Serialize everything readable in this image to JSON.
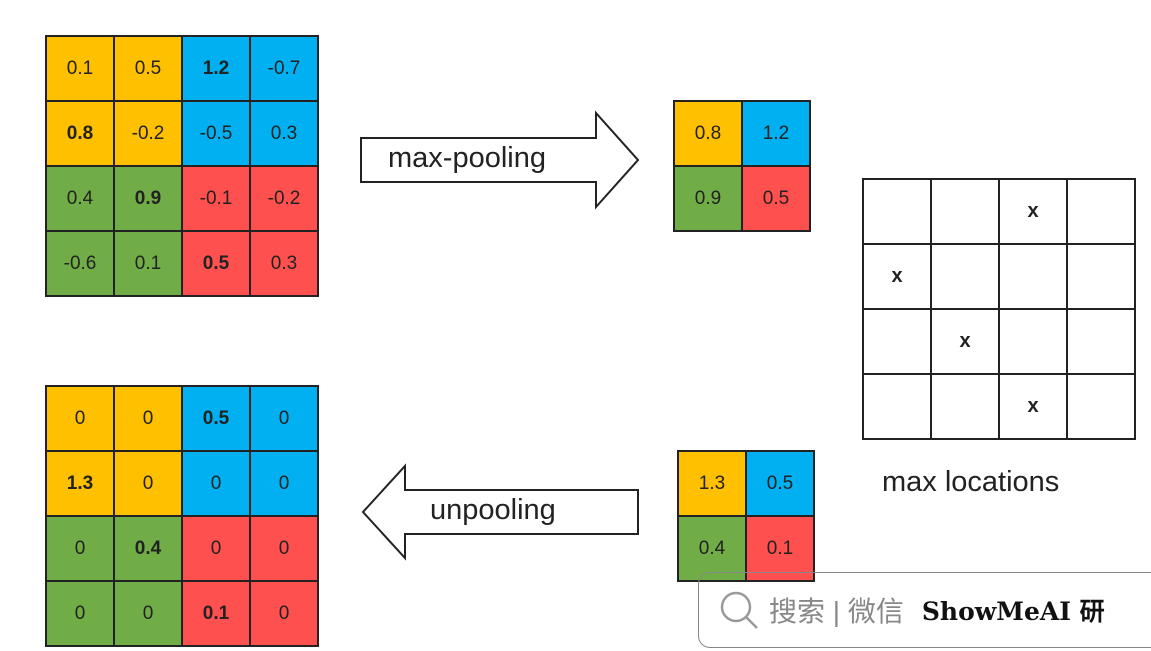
{
  "colors": {
    "yellow": "#FFC000",
    "blue": "#00B0F0",
    "green": "#70AD47",
    "red": "#FF5050"
  },
  "input_grid": {
    "values": [
      [
        "0.1",
        "0.5",
        "1.2",
        "-0.7"
      ],
      [
        "0.8",
        "-0.2",
        "-0.5",
        "0.3"
      ],
      [
        "0.4",
        "0.9",
        "-0.1",
        "-0.2"
      ],
      [
        "-0.6",
        "0.1",
        "0.5",
        "0.3"
      ]
    ],
    "bold": [
      [
        0,
        0,
        1,
        0
      ],
      [
        1,
        0,
        0,
        0
      ],
      [
        0,
        1,
        0,
        0
      ],
      [
        0,
        0,
        1,
        0
      ]
    ]
  },
  "pooled_grid": {
    "values": [
      [
        "0.8",
        "1.2"
      ],
      [
        "0.9",
        "0.5"
      ]
    ]
  },
  "max_locations": {
    "values": [
      [
        "",
        "",
        "x",
        ""
      ],
      [
        "x",
        "",
        "",
        ""
      ],
      [
        "",
        "x",
        "",
        ""
      ],
      [
        "",
        "",
        "x",
        ""
      ]
    ],
    "label": "max locations"
  },
  "unpool_input": {
    "values": [
      [
        "1.3",
        "0.5"
      ],
      [
        "0.4",
        "0.1"
      ]
    ]
  },
  "output_grid": {
    "values": [
      [
        "0",
        "0",
        "0.5",
        "0"
      ],
      [
        "1.3",
        "0",
        "0",
        "0"
      ],
      [
        "0",
        "0.4",
        "0",
        "0"
      ],
      [
        "0",
        "0",
        "0.1",
        "0"
      ]
    ],
    "bold": [
      [
        0,
        0,
        1,
        0
      ],
      [
        1,
        0,
        0,
        0
      ],
      [
        0,
        1,
        0,
        0
      ],
      [
        0,
        0,
        1,
        0
      ]
    ]
  },
  "arrows": {
    "pool": "max-pooling",
    "unpool": "unpooling"
  },
  "watermark": {
    "search": "搜索 | 微信",
    "brand": "ShowMeAI 研"
  }
}
